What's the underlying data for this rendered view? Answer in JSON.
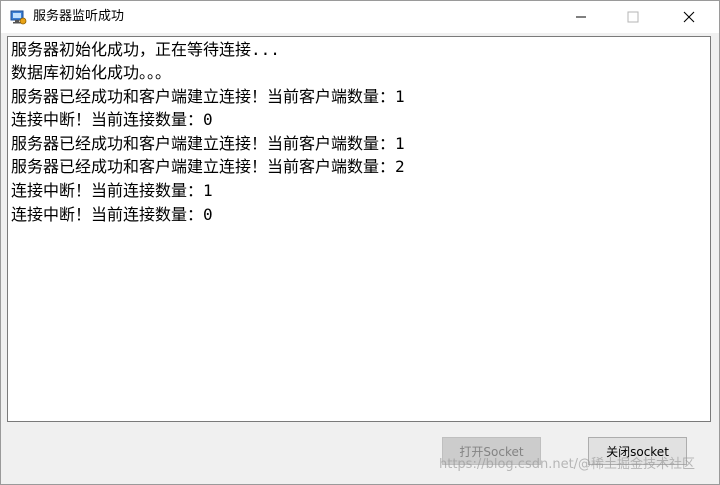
{
  "window": {
    "title": "服务器监听成功"
  },
  "log": {
    "lines": [
      "服务器初始化成功，正在等待连接...",
      "数据库初始化成功。。。",
      "服务器已经成功和客户端建立连接！当前客户端数量：1",
      "连接中断！当前连接数量：0",
      "服务器已经成功和客户端建立连接！当前客户端数量：1",
      "服务器已经成功和客户端建立连接！当前客户端数量：2",
      "连接中断！当前连接数量：1",
      "连接中断！当前连接数量：0"
    ]
  },
  "buttons": {
    "open_socket": "打开Socket",
    "close_socket": "关闭socket"
  },
  "watermark": "https://blog.csdn.net/@稀土掘金技术社区",
  "colors": {
    "titlebar_bg": "#ffffff",
    "window_bg": "#f0f0f0",
    "disabled_button": "#cccccc"
  }
}
